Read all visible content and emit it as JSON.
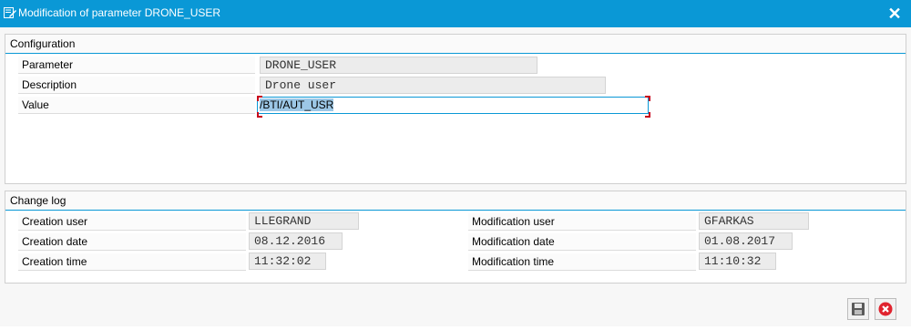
{
  "window": {
    "title": "Modification of parameter DRONE_USER",
    "close_icon": "close-icon"
  },
  "configuration": {
    "title": "Configuration",
    "parameter_label": "Parameter",
    "parameter_value": "DRONE_USER",
    "description_label": "Description",
    "description_value": "Drone user",
    "value_label": "Value",
    "value_value": "/BTI/AUT_USR"
  },
  "change_log": {
    "title": "Change log",
    "creation_user_label": "Creation user",
    "creation_user_value": "LLEGRAND",
    "creation_date_label": "Creation date",
    "creation_date_value": "08.12.2016",
    "creation_time_label": "Creation time",
    "creation_time_value": "11:32:02",
    "modification_user_label": "Modification user",
    "modification_user_value": "GFARKAS",
    "modification_date_label": "Modification date",
    "modification_date_value": "01.08.2017",
    "modification_time_label": "Modification time",
    "modification_time_value": "11:10:32"
  },
  "buttons": {
    "save_icon": "save-icon",
    "cancel_icon": "cancel-icon"
  },
  "colors": {
    "titlebar": "#0a98d6",
    "accent": "#0a98d6",
    "cancel": "#e0232e"
  }
}
